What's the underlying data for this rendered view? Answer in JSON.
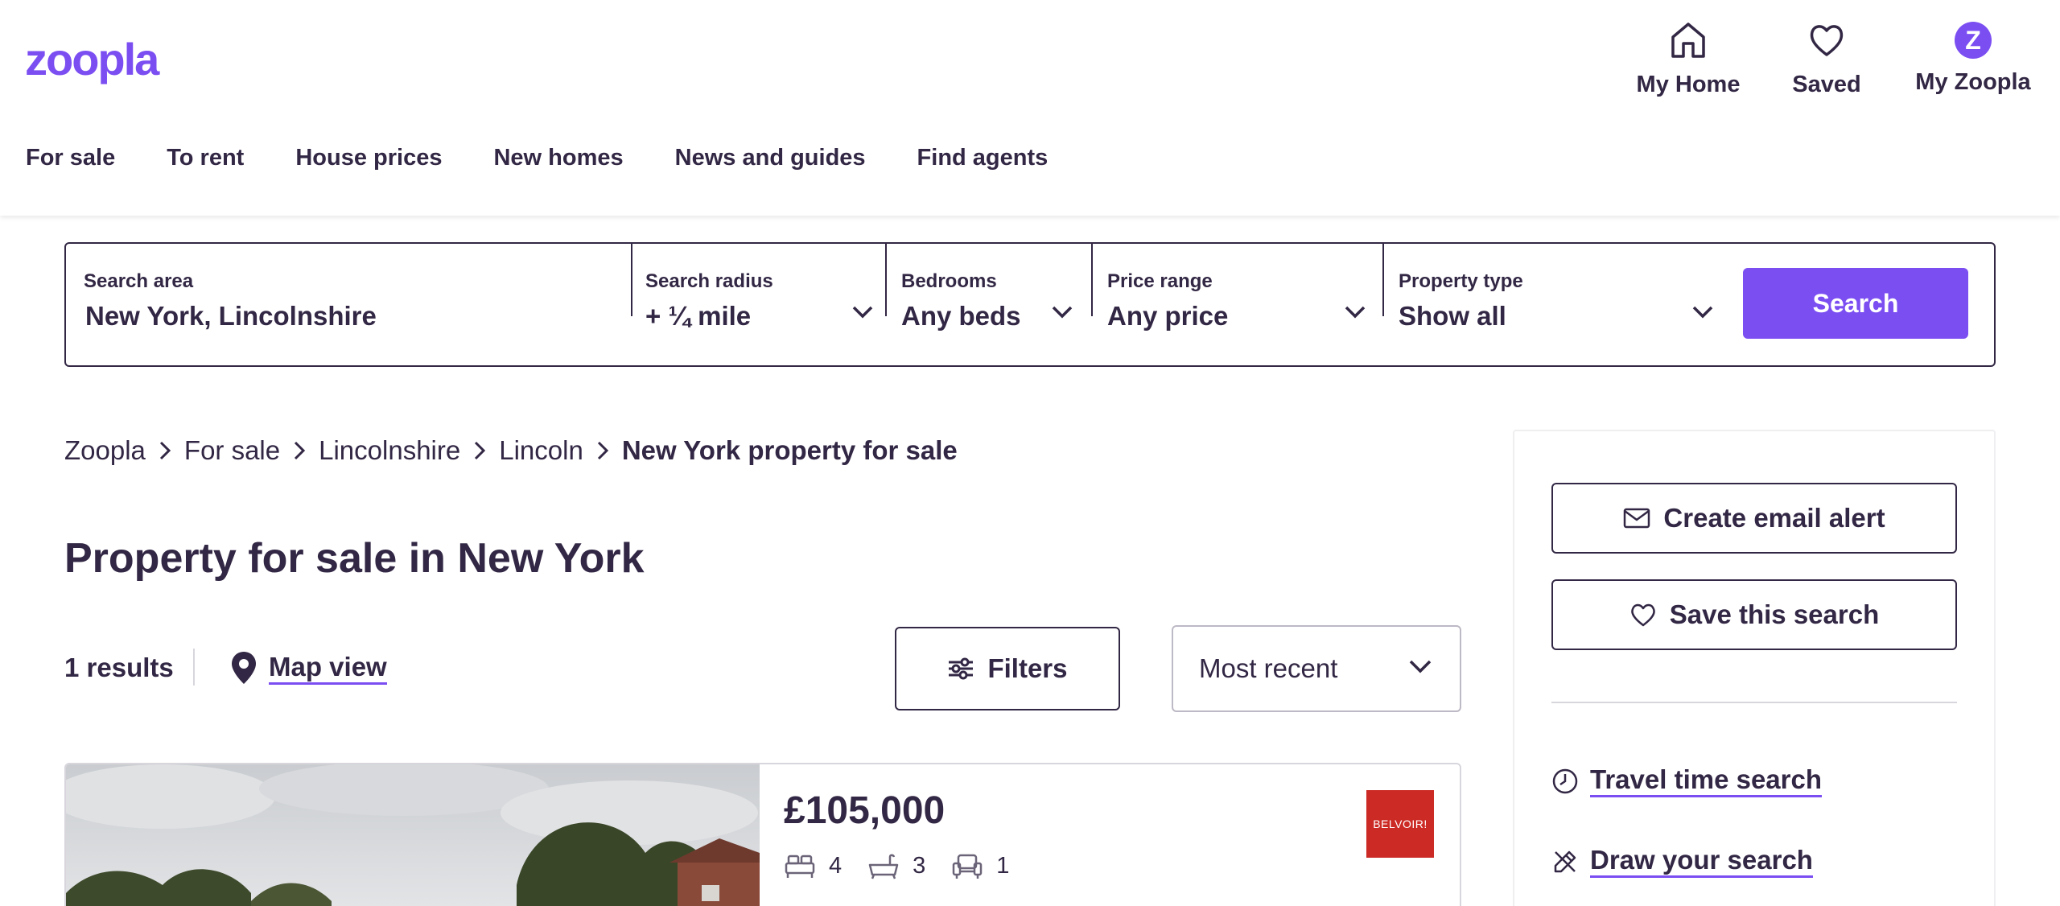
{
  "header": {
    "logo": "zoopla",
    "utils": [
      {
        "label": "My Home",
        "icon": "house-icon"
      },
      {
        "label": "Saved",
        "icon": "heart-icon"
      },
      {
        "label": "My Zoopla",
        "icon": "avatar-icon",
        "avatar_letter": "Z"
      }
    ],
    "nav": [
      "For sale",
      "To rent",
      "House prices",
      "New homes",
      "News and guides",
      "Find agents"
    ]
  },
  "search": {
    "area_label": "Search area",
    "area_value": "New York, Lincolnshire",
    "radius_label": "Search radius",
    "radius_value": "+ ¼ mile",
    "beds_label": "Bedrooms",
    "beds_value": "Any beds",
    "price_label": "Price range",
    "price_value": "Any price",
    "type_label": "Property type",
    "type_value": "Show all",
    "button": "Search"
  },
  "breadcrumb": [
    "Zoopla",
    "For sale",
    "Lincolnshire",
    "Lincoln",
    "New York property for sale"
  ],
  "page_title": "Property for sale in New York",
  "results": {
    "count": "1 results",
    "map_view": "Map view",
    "filters": "Filters",
    "sort": "Most recent"
  },
  "listing": {
    "price": "£105,000",
    "beds": "4",
    "baths": "3",
    "receptions": "1",
    "agent_logo": "BELVOIR!"
  },
  "sidebar": {
    "email_alert": "Create email alert",
    "save_search": "Save this search",
    "travel_time": "Travel time search",
    "draw_search": "Draw your search"
  },
  "colors": {
    "brand": "#7b4ef2",
    "text": "#322744",
    "agent": "#cc2a24"
  }
}
